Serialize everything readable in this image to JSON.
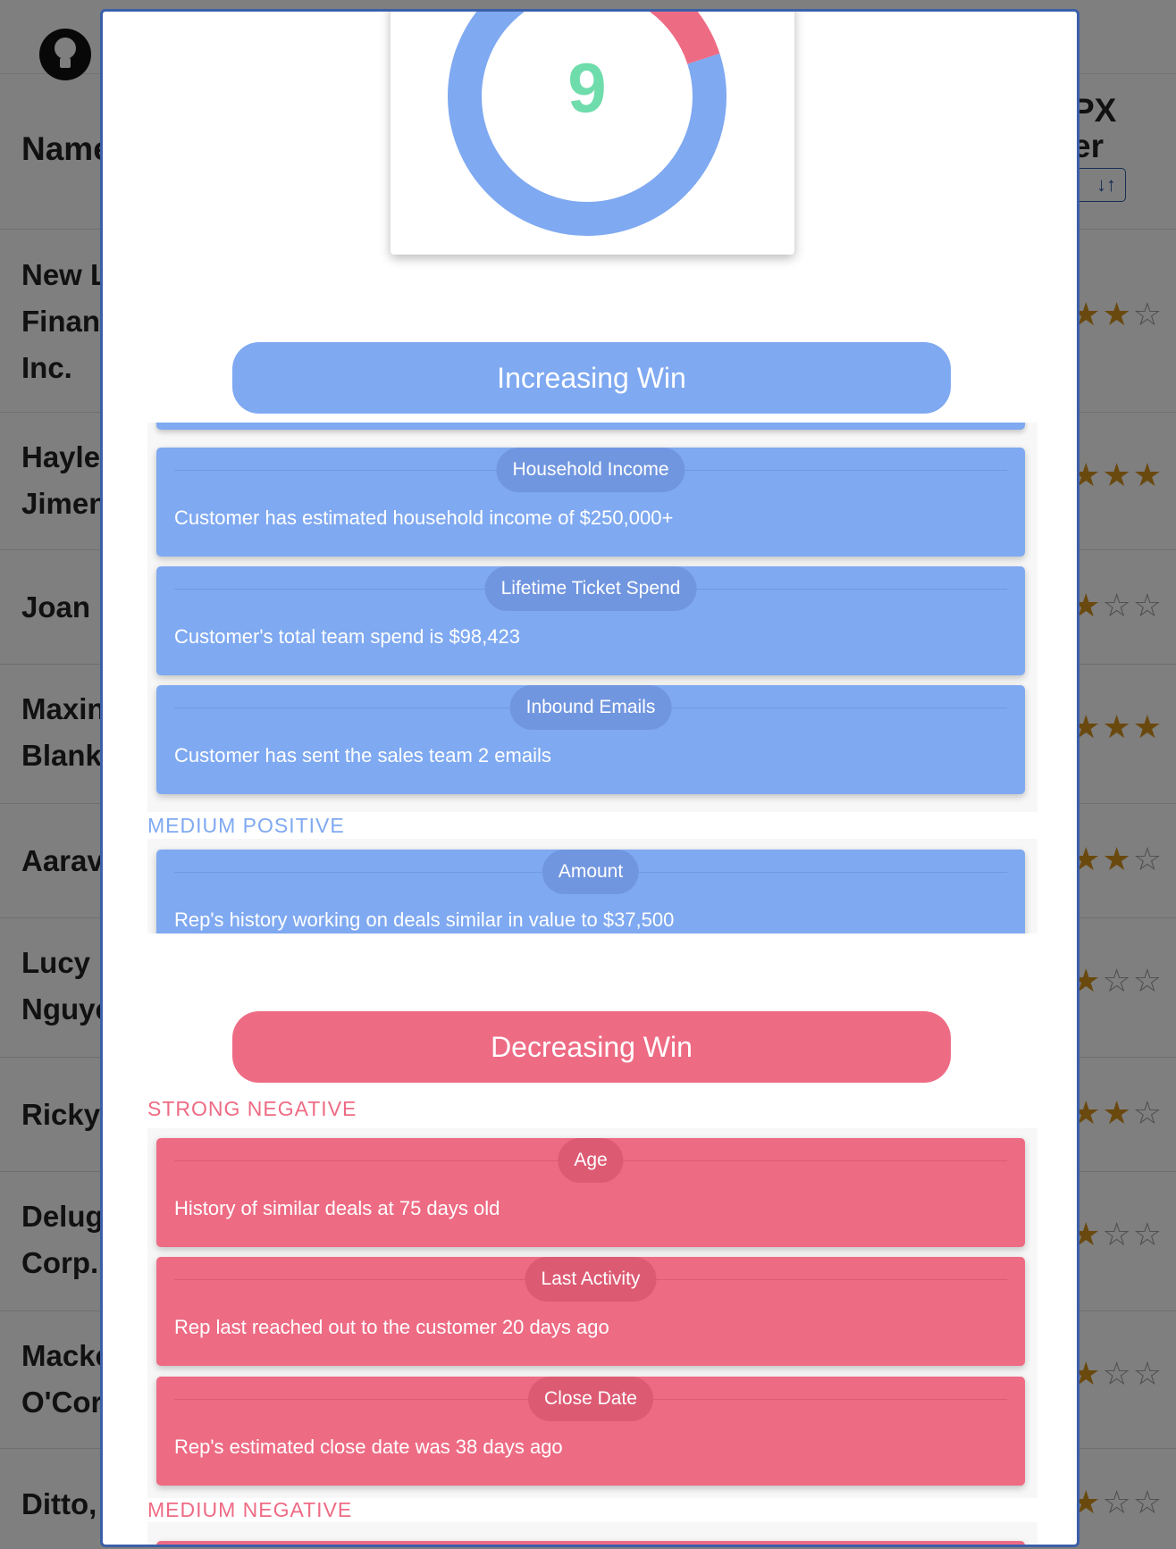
{
  "background": {
    "header": {
      "name_label": "Name",
      "right_label_1": "PX",
      "right_label_2": "er",
      "sort_glyph": "↓↑"
    },
    "rows": [
      {
        "name": "New L\nFinan\nInc.",
        "stars_filled": 2,
        "stars_visible": "★★☆"
      },
      {
        "name": "Hayle\nJimen",
        "stars_filled": 3,
        "stars_visible": "★★★"
      },
      {
        "name": "Joan",
        "stars_filled": 1,
        "stars_visible": "★☆☆"
      },
      {
        "name": "Maxin\nBlank",
        "stars_filled": 3,
        "stars_visible": "★★★"
      },
      {
        "name": "Aarav",
        "stars_filled": 2,
        "stars_visible": "★★☆"
      },
      {
        "name": "Lucy\nNguye",
        "stars_filled": 1,
        "stars_visible": "★☆☆"
      },
      {
        "name": "Ricky",
        "stars_filled": 2,
        "stars_visible": "★★☆"
      },
      {
        "name": "Delug\nCorp.",
        "stars_filled": 1,
        "stars_visible": "★☆☆"
      },
      {
        "name": "Macke\nO'Cor",
        "stars_filled": 1,
        "stars_visible": "★☆☆"
      },
      {
        "name": "Ditto,",
        "stars_filled": 1,
        "stars_visible": "★☆☆"
      }
    ]
  },
  "modal": {
    "score": {
      "value": "9",
      "positive_fraction": 0.8,
      "negative_fraction": 0.2,
      "colors": {
        "positive": "#7fa9f1",
        "negative": "#ee6b84",
        "value": "#6fdcab"
      }
    },
    "increasing": {
      "title": "Increasing Win",
      "strong_cards": [
        {
          "pill": "Household Income",
          "text": "Customer has estimated household income of $250,000+"
        },
        {
          "pill": "Lifetime Ticket Spend",
          "text": "Customer's total team spend is $98,423"
        },
        {
          "pill": "Inbound Emails",
          "text": "Customer has sent the sales team 2 emails"
        }
      ],
      "medium_label": "MEDIUM POSITIVE",
      "medium_cards": [
        {
          "pill": "Amount",
          "text": "Rep's history working on deals similar in value to $37,500"
        }
      ]
    },
    "decreasing": {
      "title": "Decreasing Win",
      "strong_label": "STRONG NEGATIVE",
      "strong_cards": [
        {
          "pill": "Age",
          "text": "History of similar deals at 75 days old"
        },
        {
          "pill": "Last Activity",
          "text": "Rep last reached out to the customer 20 days ago"
        },
        {
          "pill": "Close Date",
          "text": "Rep's estimated close date was 38 days ago"
        }
      ],
      "medium_label": "MEDIUM NEGATIVE"
    }
  }
}
